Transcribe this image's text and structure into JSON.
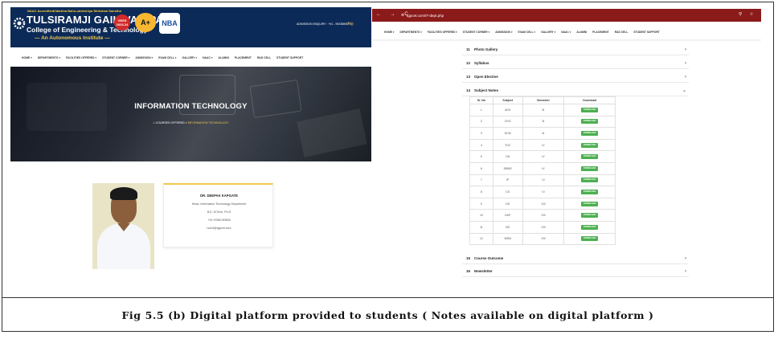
{
  "left": {
    "header": {
      "naac_tag": "NAAC Accredited",
      "vbs_tag": "Vidarbha Bahu-uddeshiya Shikshan Sanstha",
      "name": "TULSIRAMJI GAIKWAD-PATIL",
      "sub": "College of Engineering & Technology",
      "auto": "— An Autonomous Institute —",
      "badge_red": "VBSS 2023-24",
      "badge_aplus": "A+",
      "badge_nba": "NBA",
      "admission": "ADMISSION ENQUIRY : +91 - 9923869579",
      "social": "f  ◎"
    },
    "nav": [
      "HOME ▾",
      "DEPARTMENTS ▾",
      "FACILITIES OFFERED ▾",
      "STUDENT CORNER ▾",
      "ADMISSION ▾",
      "EXAM CELL ▾",
      "GALLERY ▾",
      "NAAC ▾",
      "ALUMNI",
      "PLACEMENT",
      "R&D CELL",
      "STUDENT SUPPORT"
    ],
    "hero": {
      "title": "INFORMATION TECHNOLOGY",
      "crumb_prefix": "⌂ COURSES OFFERED  »  ",
      "crumb_current": "INFORMATION TECHNOLOGY"
    },
    "hod": {
      "name": "DR. DEEPAK KAPGATE",
      "role": "Head, Information Technology Department",
      "qual": "B.E, M.Tech, Ph.D",
      "phone": "+91 97660 80808",
      "email": "hod.it@tgpcet.com"
    }
  },
  "right": {
    "browser": {
      "nav_buttons": "← → C",
      "url": "tgpcet.com/IT-dept.php",
      "icons": "⚲ ☆"
    },
    "nav": [
      "HOME ▾",
      "DEPARTMENTS ▾",
      "FACILITIES OFFERED ▾",
      "STUDENT CORNER ▾",
      "ADMISSION ▾",
      "EXAM CELL ▾",
      "GALLERY ▾",
      "NAAC ▾",
      "ALUMNI",
      "PLACEMENT",
      "R&D CELL",
      "STUDENT SUPPORT"
    ],
    "sections": [
      {
        "num": "11",
        "label": "Photo Gallery",
        "chev": "›"
      },
      {
        "num": "12",
        "label": "Syllabus",
        "chev": "›"
      },
      {
        "num": "13",
        "label": "Open Elective",
        "chev": "›"
      },
      {
        "num": "14",
        "label": "Subject Notes",
        "chev": "⌄"
      },
      {
        "num": "15",
        "label": "Course Outcome",
        "chev": "›"
      },
      {
        "num": "16",
        "label": "Newsletter",
        "chev": "›"
      }
    ],
    "table": {
      "headers": [
        "Sr. No",
        "Subject",
        "Semester",
        "Download"
      ],
      "download_label": "DOWNLOAD",
      "rows": [
        [
          "1",
          "ADS",
          "III"
        ],
        [
          "2",
          "OVO",
          "III"
        ],
        [
          "3",
          "DCM",
          "III"
        ],
        [
          "4",
          "TOC",
          "IV"
        ],
        [
          "5",
          "CN",
          "IV"
        ],
        [
          "6",
          "DBMS",
          "IV"
        ],
        [
          "7",
          "IP",
          "VI"
        ],
        [
          "8",
          "CS",
          "VI"
        ],
        [
          "9",
          "DS",
          "VIII"
        ],
        [
          "10",
          "DAP",
          "VIII"
        ],
        [
          "11",
          "BS",
          "VIII"
        ],
        [
          "12",
          "WDM",
          "VIII"
        ]
      ]
    }
  },
  "caption": "Fig 5.5 (b) Digital platform provided to students ( Notes available on digital platform )"
}
